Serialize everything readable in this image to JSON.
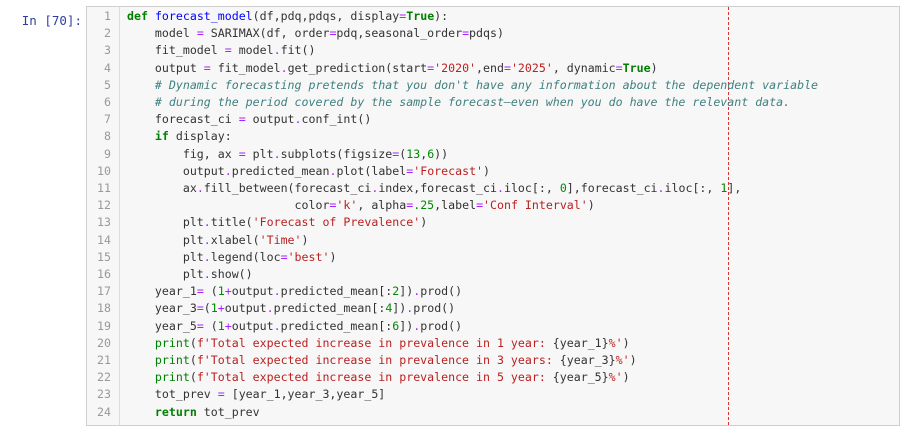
{
  "cell": {
    "prompt": "In [70]:",
    "lines": [
      {
        "n": "1",
        "t": [
          {
            "c": "kw",
            "s": "def"
          },
          {
            "c": "",
            "s": " "
          },
          {
            "c": "def",
            "s": "forecast_model"
          },
          {
            "c": "",
            "s": "(df,pdq,pdqs, display"
          },
          {
            "c": "op",
            "s": "="
          },
          {
            "c": "kw",
            "s": "True"
          },
          {
            "c": "",
            "s": "):"
          }
        ]
      },
      {
        "n": "2",
        "t": [
          {
            "c": "",
            "s": "    model "
          },
          {
            "c": "op",
            "s": "="
          },
          {
            "c": "",
            "s": " SARIMAX(df, order"
          },
          {
            "c": "op",
            "s": "="
          },
          {
            "c": "",
            "s": "pdq,seasonal_order"
          },
          {
            "c": "op",
            "s": "="
          },
          {
            "c": "",
            "s": "pdqs)"
          }
        ]
      },
      {
        "n": "3",
        "t": [
          {
            "c": "",
            "s": "    fit_model "
          },
          {
            "c": "op",
            "s": "="
          },
          {
            "c": "",
            "s": " model"
          },
          {
            "c": "op",
            "s": "."
          },
          {
            "c": "",
            "s": "fit()"
          }
        ]
      },
      {
        "n": "4",
        "t": [
          {
            "c": "",
            "s": "    output "
          },
          {
            "c": "op",
            "s": "="
          },
          {
            "c": "",
            "s": " fit_model"
          },
          {
            "c": "op",
            "s": "."
          },
          {
            "c": "",
            "s": "get_prediction(start"
          },
          {
            "c": "op",
            "s": "="
          },
          {
            "c": "str",
            "s": "'2020'"
          },
          {
            "c": "",
            "s": ",end"
          },
          {
            "c": "op",
            "s": "="
          },
          {
            "c": "str",
            "s": "'2025'"
          },
          {
            "c": "",
            "s": ", dynamic"
          },
          {
            "c": "op",
            "s": "="
          },
          {
            "c": "kw",
            "s": "True"
          },
          {
            "c": "",
            "s": ")"
          }
        ]
      },
      {
        "n": "5",
        "t": [
          {
            "c": "",
            "s": "    "
          },
          {
            "c": "cm",
            "s": "# Dynamic forecasting pretends that you don't have any information about the dependent variable"
          }
        ]
      },
      {
        "n": "6",
        "t": [
          {
            "c": "",
            "s": "    "
          },
          {
            "c": "cm",
            "s": "# during the period covered by the sample forecast—even when you do have the relevant data."
          }
        ]
      },
      {
        "n": "7",
        "t": [
          {
            "c": "",
            "s": "    forecast_ci "
          },
          {
            "c": "op",
            "s": "="
          },
          {
            "c": "",
            "s": " output"
          },
          {
            "c": "op",
            "s": "."
          },
          {
            "c": "",
            "s": "conf_int()"
          }
        ]
      },
      {
        "n": "8",
        "t": [
          {
            "c": "",
            "s": "    "
          },
          {
            "c": "kw",
            "s": "if"
          },
          {
            "c": "",
            "s": " display:"
          }
        ]
      },
      {
        "n": "9",
        "t": [
          {
            "c": "",
            "s": "        fig, ax "
          },
          {
            "c": "op",
            "s": "="
          },
          {
            "c": "",
            "s": " plt"
          },
          {
            "c": "op",
            "s": "."
          },
          {
            "c": "",
            "s": "subplots(figsize"
          },
          {
            "c": "op",
            "s": "="
          },
          {
            "c": "",
            "s": "("
          },
          {
            "c": "num",
            "s": "13"
          },
          {
            "c": "",
            "s": ","
          },
          {
            "c": "num",
            "s": "6"
          },
          {
            "c": "",
            "s": "))"
          }
        ]
      },
      {
        "n": "10",
        "t": [
          {
            "c": "",
            "s": "        output"
          },
          {
            "c": "op",
            "s": "."
          },
          {
            "c": "",
            "s": "predicted_mean"
          },
          {
            "c": "op",
            "s": "."
          },
          {
            "c": "",
            "s": "plot(label"
          },
          {
            "c": "op",
            "s": "="
          },
          {
            "c": "str",
            "s": "'Forecast'"
          },
          {
            "c": "",
            "s": ")"
          }
        ]
      },
      {
        "n": "11",
        "t": [
          {
            "c": "",
            "s": "        ax"
          },
          {
            "c": "op",
            "s": "."
          },
          {
            "c": "",
            "s": "fill_between(forecast_ci"
          },
          {
            "c": "op",
            "s": "."
          },
          {
            "c": "",
            "s": "index,forecast_ci"
          },
          {
            "c": "op",
            "s": "."
          },
          {
            "c": "",
            "s": "iloc[:, "
          },
          {
            "c": "num",
            "s": "0"
          },
          {
            "c": "",
            "s": "],forecast_ci"
          },
          {
            "c": "op",
            "s": "."
          },
          {
            "c": "",
            "s": "iloc[:, "
          },
          {
            "c": "num",
            "s": "1"
          },
          {
            "c": "",
            "s": "],"
          }
        ]
      },
      {
        "n": "12",
        "t": [
          {
            "c": "",
            "s": "                        color"
          },
          {
            "c": "op",
            "s": "="
          },
          {
            "c": "str",
            "s": "'k'"
          },
          {
            "c": "",
            "s": ", alpha"
          },
          {
            "c": "op",
            "s": "="
          },
          {
            "c": "num",
            "s": ".25"
          },
          {
            "c": "",
            "s": ",label"
          },
          {
            "c": "op",
            "s": "="
          },
          {
            "c": "str",
            "s": "'Conf Interval'"
          },
          {
            "c": "",
            "s": ")"
          }
        ]
      },
      {
        "n": "13",
        "t": [
          {
            "c": "",
            "s": "        plt"
          },
          {
            "c": "op",
            "s": "."
          },
          {
            "c": "",
            "s": "title("
          },
          {
            "c": "str",
            "s": "'Forecast of Prevalence'"
          },
          {
            "c": "",
            "s": ")"
          }
        ]
      },
      {
        "n": "14",
        "t": [
          {
            "c": "",
            "s": "        plt"
          },
          {
            "c": "op",
            "s": "."
          },
          {
            "c": "",
            "s": "xlabel("
          },
          {
            "c": "str",
            "s": "'Time'"
          },
          {
            "c": "",
            "s": ")"
          }
        ]
      },
      {
        "n": "15",
        "t": [
          {
            "c": "",
            "s": "        plt"
          },
          {
            "c": "op",
            "s": "."
          },
          {
            "c": "",
            "s": "legend(loc"
          },
          {
            "c": "op",
            "s": "="
          },
          {
            "c": "str",
            "s": "'best'"
          },
          {
            "c": "",
            "s": ")"
          }
        ]
      },
      {
        "n": "16",
        "t": [
          {
            "c": "",
            "s": "        plt"
          },
          {
            "c": "op",
            "s": "."
          },
          {
            "c": "",
            "s": "show()"
          }
        ]
      },
      {
        "n": "17",
        "t": [
          {
            "c": "",
            "s": "    year_1"
          },
          {
            "c": "op",
            "s": "="
          },
          {
            "c": "",
            "s": " ("
          },
          {
            "c": "num",
            "s": "1"
          },
          {
            "c": "op",
            "s": "+"
          },
          {
            "c": "",
            "s": "output"
          },
          {
            "c": "op",
            "s": "."
          },
          {
            "c": "",
            "s": "predicted_mean[:"
          },
          {
            "c": "num",
            "s": "2"
          },
          {
            "c": "",
            "s": "])"
          },
          {
            "c": "op",
            "s": "."
          },
          {
            "c": "",
            "s": "prod()"
          }
        ]
      },
      {
        "n": "18",
        "t": [
          {
            "c": "",
            "s": "    year_3"
          },
          {
            "c": "op",
            "s": "="
          },
          {
            "c": "",
            "s": "("
          },
          {
            "c": "num",
            "s": "1"
          },
          {
            "c": "op",
            "s": "+"
          },
          {
            "c": "",
            "s": "output"
          },
          {
            "c": "op",
            "s": "."
          },
          {
            "c": "",
            "s": "predicted_mean[:"
          },
          {
            "c": "num",
            "s": "4"
          },
          {
            "c": "",
            "s": "])"
          },
          {
            "c": "op",
            "s": "."
          },
          {
            "c": "",
            "s": "prod()"
          }
        ]
      },
      {
        "n": "19",
        "t": [
          {
            "c": "",
            "s": "    year_5"
          },
          {
            "c": "op",
            "s": "="
          },
          {
            "c": "",
            "s": " ("
          },
          {
            "c": "num",
            "s": "1"
          },
          {
            "c": "op",
            "s": "+"
          },
          {
            "c": "",
            "s": "output"
          },
          {
            "c": "op",
            "s": "."
          },
          {
            "c": "",
            "s": "predicted_mean[:"
          },
          {
            "c": "num",
            "s": "6"
          },
          {
            "c": "",
            "s": "])"
          },
          {
            "c": "op",
            "s": "."
          },
          {
            "c": "",
            "s": "prod()"
          }
        ]
      },
      {
        "n": "20",
        "t": [
          {
            "c": "",
            "s": "    "
          },
          {
            "c": "bi",
            "s": "print"
          },
          {
            "c": "",
            "s": "("
          },
          {
            "c": "str",
            "s": "f'Total expected increase in prevalence in 1 year: "
          },
          {
            "c": "",
            "s": "{year_1}"
          },
          {
            "c": "str",
            "s": "%'"
          },
          {
            "c": "",
            "s": ")"
          }
        ]
      },
      {
        "n": "21",
        "t": [
          {
            "c": "",
            "s": "    "
          },
          {
            "c": "bi",
            "s": "print"
          },
          {
            "c": "",
            "s": "("
          },
          {
            "c": "str",
            "s": "f'Total expected increase in prevalence in 3 years: "
          },
          {
            "c": "",
            "s": "{year_3}"
          },
          {
            "c": "str",
            "s": "%'"
          },
          {
            "c": "",
            "s": ")"
          }
        ]
      },
      {
        "n": "22",
        "t": [
          {
            "c": "",
            "s": "    "
          },
          {
            "c": "bi",
            "s": "print"
          },
          {
            "c": "",
            "s": "("
          },
          {
            "c": "str",
            "s": "f'Total expected increase in prevalence in 5 year: "
          },
          {
            "c": "",
            "s": "{year_5}"
          },
          {
            "c": "str",
            "s": "%'"
          },
          {
            "c": "",
            "s": ")"
          }
        ]
      },
      {
        "n": "23",
        "t": [
          {
            "c": "",
            "s": "    tot_prev "
          },
          {
            "c": "op",
            "s": "="
          },
          {
            "c": "",
            "s": " [year_1,year_3,year_5]"
          }
        ]
      },
      {
        "n": "24",
        "t": [
          {
            "c": "",
            "s": "    "
          },
          {
            "c": "kw",
            "s": "return"
          },
          {
            "c": "",
            "s": " tot_prev"
          }
        ]
      }
    ]
  },
  "colors": {
    "prompt": "#303f9f",
    "keyword": "#008000",
    "function_name": "#0000ff",
    "string": "#ba2121",
    "comment": "#408080",
    "ruler": "#e03030",
    "editor_bg": "#f7f7f7"
  }
}
